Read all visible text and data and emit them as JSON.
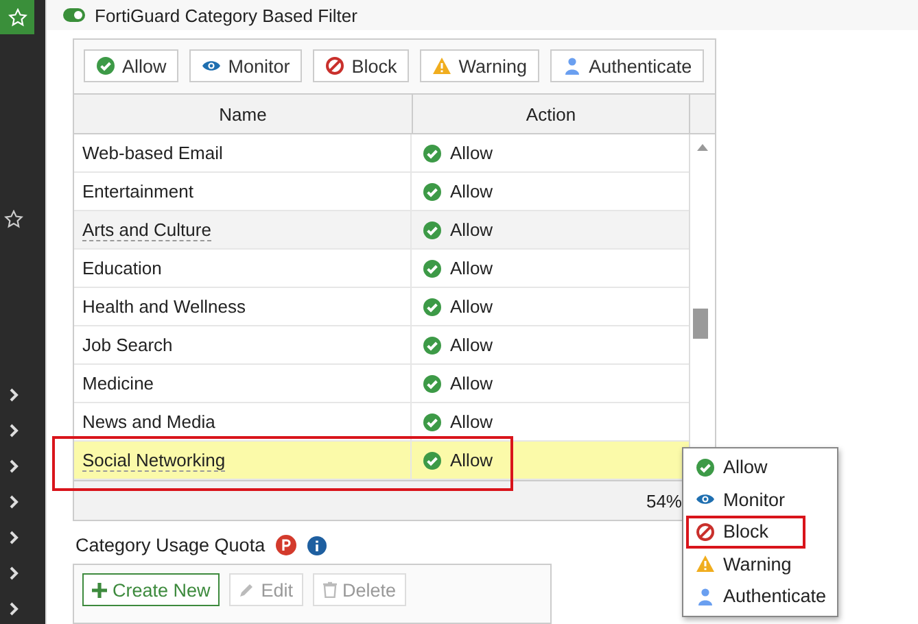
{
  "section": {
    "enabled": true,
    "title": "FortiGuard Category Based Filter"
  },
  "action_buttons": [
    {
      "label": "Allow",
      "kind": "allow"
    },
    {
      "label": "Monitor",
      "kind": "monitor"
    },
    {
      "label": "Block",
      "kind": "block"
    },
    {
      "label": "Warning",
      "kind": "warning"
    },
    {
      "label": "Authenticate",
      "kind": "authenticate"
    }
  ],
  "table": {
    "columns": [
      "Name",
      "Action"
    ],
    "rows": [
      {
        "name": "Web-based Email",
        "action": "Allow",
        "kind": "allow",
        "selected": false,
        "hovered": false,
        "annotated": false,
        "underlined": false
      },
      {
        "name": "Entertainment",
        "action": "Allow",
        "kind": "allow",
        "selected": false,
        "hovered": false,
        "annotated": false,
        "underlined": false
      },
      {
        "name": "Arts and Culture",
        "action": "Allow",
        "kind": "allow",
        "selected": false,
        "hovered": true,
        "annotated": false,
        "underlined": true
      },
      {
        "name": "Education",
        "action": "Allow",
        "kind": "allow",
        "selected": false,
        "hovered": false,
        "annotated": false,
        "underlined": false
      },
      {
        "name": "Health and Wellness",
        "action": "Allow",
        "kind": "allow",
        "selected": false,
        "hovered": false,
        "annotated": false,
        "underlined": false
      },
      {
        "name": "Job Search",
        "action": "Allow",
        "kind": "allow",
        "selected": false,
        "hovered": false,
        "annotated": false,
        "underlined": false
      },
      {
        "name": "Medicine",
        "action": "Allow",
        "kind": "allow",
        "selected": false,
        "hovered": false,
        "annotated": false,
        "underlined": false
      },
      {
        "name": "News and Media",
        "action": "Allow",
        "kind": "allow",
        "selected": false,
        "hovered": false,
        "annotated": false,
        "underlined": false
      },
      {
        "name": "Social Networking",
        "action": "Allow",
        "kind": "allow",
        "selected": true,
        "hovered": false,
        "annotated": true,
        "underlined": true
      }
    ],
    "footer": "54%"
  },
  "quota": {
    "title": "Category Usage Quota",
    "buttons": [
      {
        "label": "Create New",
        "kind": "create",
        "disabled": false
      },
      {
        "label": "Edit",
        "kind": "edit",
        "disabled": true
      },
      {
        "label": "Delete",
        "kind": "delete",
        "disabled": true
      }
    ]
  },
  "menu": {
    "items": [
      {
        "label": "Allow",
        "kind": "allow",
        "annotated": false
      },
      {
        "label": "Monitor",
        "kind": "monitor",
        "annotated": false
      },
      {
        "label": "Block",
        "kind": "block",
        "annotated": true
      },
      {
        "label": "Warning",
        "kind": "warning",
        "annotated": false
      },
      {
        "label": "Authenticate",
        "kind": "authenticate",
        "annotated": false
      }
    ]
  }
}
